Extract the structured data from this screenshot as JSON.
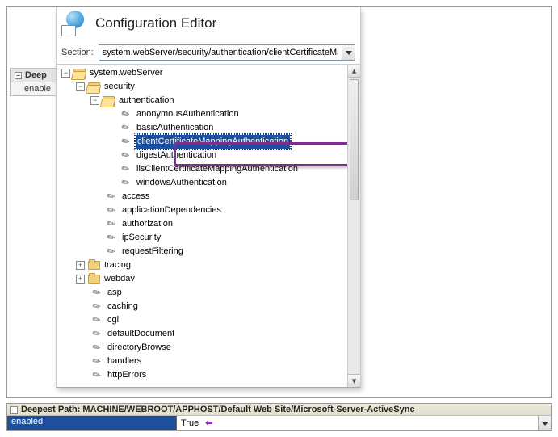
{
  "header": {
    "title": "Configuration Editor"
  },
  "section": {
    "label": "Section:",
    "value": "system.webServer/security/authentication/clientCertificateMappingA"
  },
  "bg_panel": {
    "header": "Deep",
    "prop": "enable"
  },
  "tree": {
    "root": "system.webServer",
    "security": "security",
    "authentication": "authentication",
    "auth_children": [
      "anonymousAuthentication",
      "basicAuthentication",
      "clientCertificateMappingAuthentication",
      "digestAuthentication",
      "iisClientCertificateMappingAuthentication",
      "windowsAuthentication"
    ],
    "security_children": [
      "access",
      "applicationDependencies",
      "authorization",
      "ipSecurity",
      "requestFiltering"
    ],
    "tracing": "tracing",
    "webdav": "webdav",
    "top_children": [
      "asp",
      "caching",
      "cgi",
      "defaultDocument",
      "directoryBrowse",
      "handlers",
      "httpErrors"
    ]
  },
  "bottom": {
    "path_label": "Deepest Path:",
    "path_value": "MACHINE/WEBROOT/APPHOST/Default Web Site/Microsoft-Server-ActiveSync",
    "prop_name": "enabled",
    "prop_value": "True"
  }
}
